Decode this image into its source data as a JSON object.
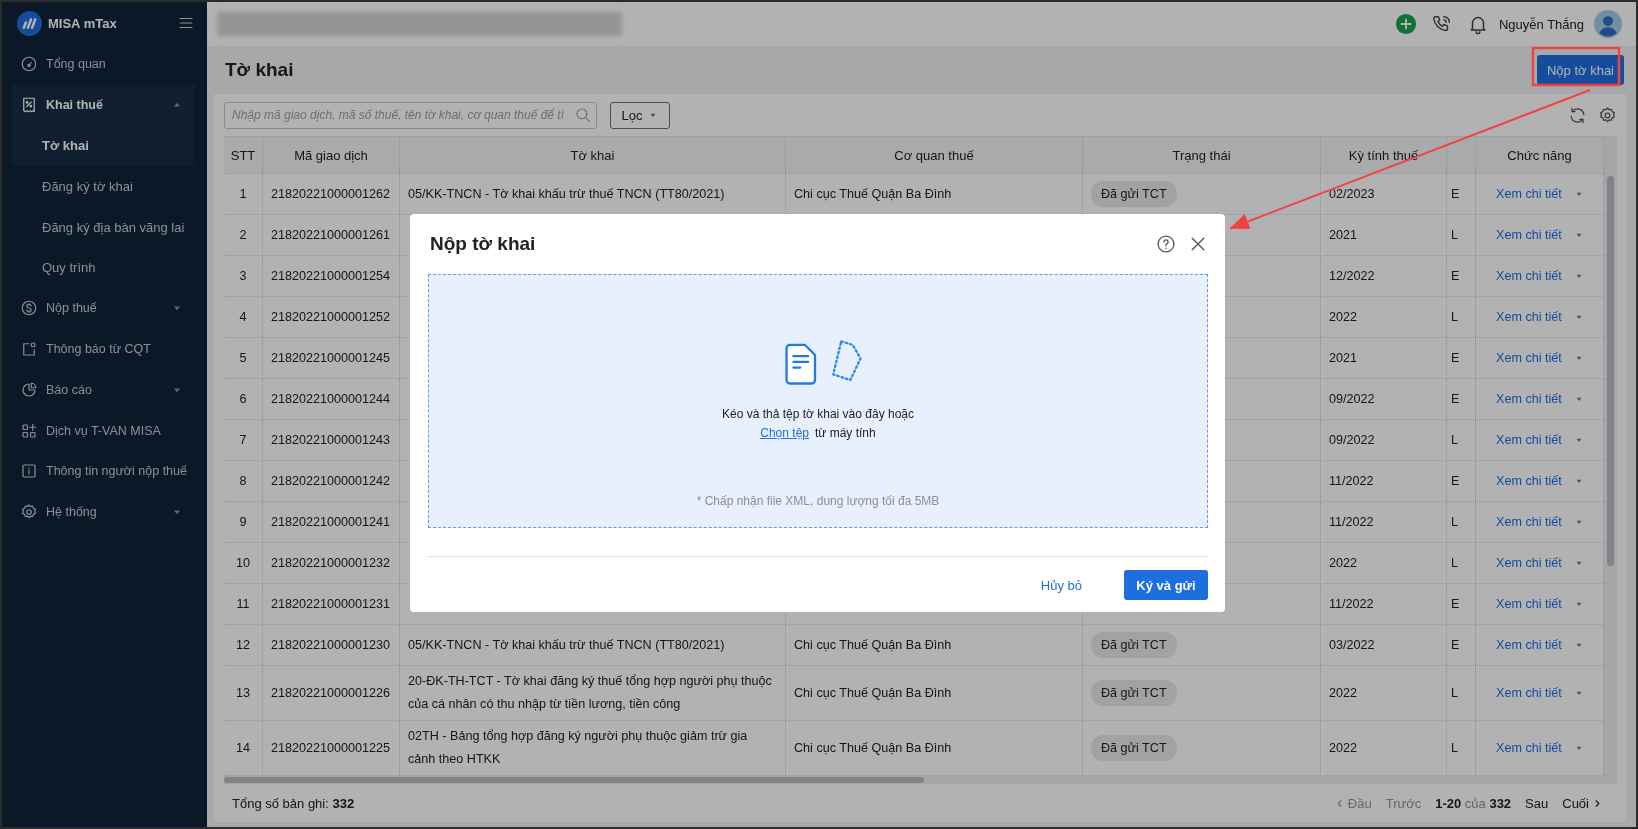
{
  "sidebar": {
    "brand": "MISA mTax",
    "items": [
      {
        "label": "Tổng quan",
        "selected": false
      },
      {
        "label": "Khai thuế",
        "selected": true,
        "expanded": true,
        "children": [
          {
            "label": "Tờ khai",
            "selected": true
          },
          {
            "label": "Đăng ký tờ khai",
            "selected": false
          },
          {
            "label": "Đăng ký địa bàn vãng lai",
            "selected": false
          },
          {
            "label": "Quy trình",
            "selected": false
          }
        ]
      },
      {
        "label": "Nộp thuế",
        "selected": false,
        "expanded": false
      },
      {
        "label": "Thông báo từ CQT",
        "selected": false
      },
      {
        "label": "Báo cáo",
        "selected": false,
        "expanded": false
      },
      {
        "label": "Dịch vụ T-VAN MISA",
        "selected": false
      },
      {
        "label": "Thông tin người nộp thuế",
        "selected": false
      },
      {
        "label": "Hệ thống",
        "selected": false,
        "expanded": false
      }
    ]
  },
  "topbar": {
    "user_name": "Nguyễn Thắng"
  },
  "page": {
    "title": "Tờ khai",
    "submit_button": "Nộp tờ khai"
  },
  "toolbar": {
    "search": {
      "placeholder": "Nhập mã giao dịch, mã số thuế, tên tờ khai, cơ quan thuế để tì"
    },
    "filter_button": "Lọc"
  },
  "table": {
    "columns": [
      {
        "label": "STT",
        "kind": "text"
      },
      {
        "label": "Mã giao dịch",
        "kind": "text"
      },
      {
        "label": "Tờ khai",
        "kind": "text"
      },
      {
        "label": "Cơ quan thuế",
        "kind": "text"
      },
      {
        "label": "Trạng thái",
        "kind": "badge"
      },
      {
        "label": "Kỳ tính thuế",
        "kind": "text"
      },
      {
        "kind": "text"
      },
      {
        "label": "Chức năng",
        "kind": "link"
      }
    ],
    "rows": [
      {
        "stt": "1",
        "ma_giao_dich": "21820221000001262",
        "to_khai": "05/KK-TNCN - Tờ khai khấu trừ thuế TNCN (TT80/2021)",
        "co_quan_thue": "Chi cục Thuế Quận Ba Đình",
        "trang_thai": "Đã gửi TCT",
        "ky_tinh_thue": "02/2023",
        "column_7": "E",
        "chuc_nang": "Xem chi tiết"
      },
      {
        "stt": "2",
        "ma_giao_dich": "21820221000001261",
        "ky_tinh_thue": "2021",
        "column_7": "L",
        "chuc_nang": "Xem chi tiết"
      },
      {
        "stt": "3",
        "ma_giao_dich": "21820221000001254",
        "ky_tinh_thue": "12/2022",
        "column_7": "E",
        "chuc_nang": "Xem chi tiết"
      },
      {
        "stt": "4",
        "ma_giao_dich": "21820221000001252",
        "ky_tinh_thue": "2022",
        "column_7": "L",
        "chuc_nang": "Xem chi tiết"
      },
      {
        "stt": "5",
        "ma_giao_dich": "21820221000001245",
        "ky_tinh_thue": "2021",
        "column_7": "E",
        "chuc_nang": "Xem chi tiết"
      },
      {
        "stt": "6",
        "ma_giao_dich": "21820221000001244",
        "ky_tinh_thue": "09/2022",
        "column_7": "E",
        "chuc_nang": "Xem chi tiết"
      },
      {
        "stt": "7",
        "ma_giao_dich": "21820221000001243",
        "ky_tinh_thue": "09/2022",
        "column_7": "L",
        "chuc_nang": "Xem chi tiết"
      },
      {
        "stt": "8",
        "ma_giao_dich": "21820221000001242",
        "ky_tinh_thue": "11/2022",
        "column_7": "E",
        "chuc_nang": "Xem chi tiết"
      },
      {
        "stt": "9",
        "ma_giao_dich": "21820221000001241",
        "ky_tinh_thue": "11/2022",
        "column_7": "L",
        "chuc_nang": "Xem chi tiết"
      },
      {
        "stt": "10",
        "ma_giao_dich": "21820221000001232",
        "ky_tinh_thue": "2022",
        "column_7": "L",
        "chuc_nang": "Xem chi tiết"
      },
      {
        "stt": "11",
        "ma_giao_dich": "21820221000001231",
        "ky_tinh_thue": "11/2022",
        "column_7": "E",
        "chuc_nang": "Xem chi tiết"
      },
      {
        "stt": "12",
        "ma_giao_dich": "21820221000001230",
        "to_khai": "05/KK-TNCN - Tờ khai khấu trừ thuế TNCN (TT80/2021)",
        "co_quan_thue": "Chi cục Thuế Quận Ba Đình",
        "trang_thai": "Đã gửi TCT",
        "ky_tinh_thue": "03/2022",
        "column_7": "E",
        "chuc_nang": "Xem chi tiết"
      },
      {
        "stt": "13",
        "ma_giao_dich": "21820221000001226",
        "to_khai": "20-ĐK-TH-TCT - Tờ khai đăng ký thuế tổng hợp người phụ thuộc của cá nhân có thu nhập từ tiền lương, tiền công",
        "co_quan_thue": "Chi cục Thuế Quận Ba Đình",
        "trang_thai": "Đã gửi TCT",
        "ky_tinh_thue": "2022",
        "column_7": "L",
        "chuc_nang": "Xem chi tiết"
      },
      {
        "stt": "14",
        "ma_giao_dich": "21820221000001225",
        "to_khai": "02TH - Bảng tổng hợp đăng ký người phụ thuộc giảm trừ gia cảnh theo HTKK",
        "co_quan_thue": "Chi cục Thuế Quận Ba Đình",
        "trang_thai": "Đã gửi TCT",
        "ky_tinh_thue": "2022",
        "column_7": "L",
        "chuc_nang": "Xem chi tiết"
      }
    ]
  },
  "footer": {
    "total": "Tổng số bản ghi: **332**",
    "pagination": [
      {
        "kind": "first",
        "label": "Đầu",
        "disabled": true
      },
      {
        "kind": "prev",
        "label": "Trước",
        "disabled": true
      },
      {
        "kind": "range",
        "label": "**1-20** của **332**"
      },
      {
        "kind": "next",
        "label": "Sau",
        "disabled": false
      },
      {
        "kind": "last",
        "label": "Cuối",
        "disabled": false
      }
    ]
  },
  "modal": {
    "title": "Nộp tờ khai",
    "drop_text": "Kéo và thả tệp tờ khai vào đây hoặc",
    "choose_link": "Chọn tệp",
    "choose_suffix": "từ máy tính",
    "note": "* Chấp nhận file XML, dung lượng tối đa 5MB",
    "cancel_button": "Hủy bỏ",
    "confirm_button": "Ký và gửi"
  }
}
